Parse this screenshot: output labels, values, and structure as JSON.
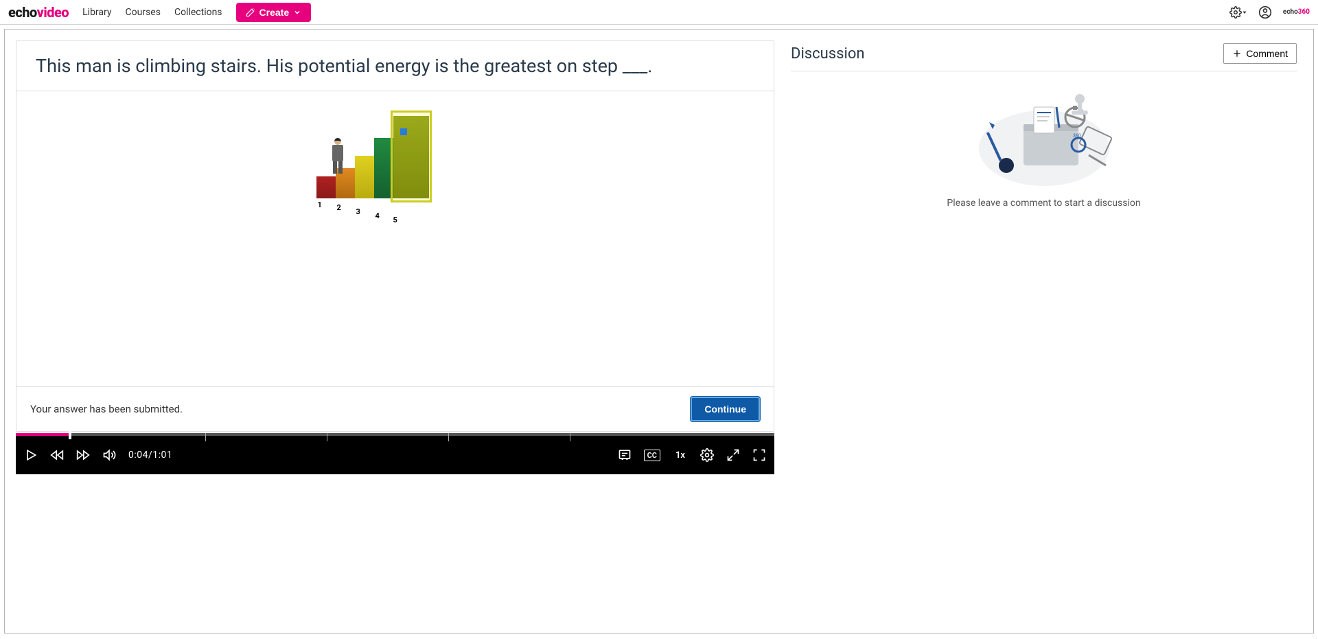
{
  "brand": {
    "part1": "echo",
    "part2": "video"
  },
  "nav": {
    "library": "Library",
    "courses": "Courses",
    "collections": "Collections",
    "create": "Create"
  },
  "mini_brand": {
    "part1": "echo",
    "part2": "360"
  },
  "question": {
    "prompt": "This man is climbing stairs. His potential energy is the greatest on step ___.",
    "steps": [
      "1",
      "2",
      "3",
      "4",
      "5"
    ],
    "status": "Your answer has been submitted.",
    "continue_label": "Continue"
  },
  "player": {
    "time": "0:04/1:01",
    "speed": "1x",
    "cc": "CC"
  },
  "discussion": {
    "title": "Discussion",
    "comment_label": "Comment",
    "empty_prompt": "Please leave a comment to start a discussion"
  }
}
